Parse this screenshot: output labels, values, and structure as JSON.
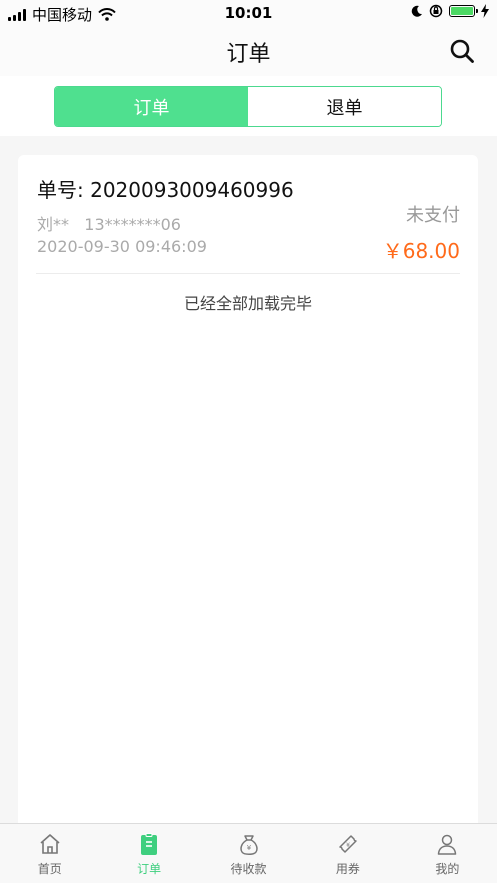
{
  "status_bar": {
    "carrier": "中国移动",
    "time": "10:01"
  },
  "nav": {
    "title": "订单"
  },
  "segments": [
    {
      "label": "订单",
      "active": true
    },
    {
      "label": "退单",
      "active": false
    }
  ],
  "order": {
    "number": "单号: 2020093009460996",
    "user": "刘**   13*******06",
    "time": "2020-09-30 09:46:09",
    "status": "未支付",
    "price": "￥68.00"
  },
  "list_footer": "已经全部加载完毕",
  "tabbar": [
    {
      "label": "首页",
      "icon": "home-icon"
    },
    {
      "label": "订单",
      "icon": "clipboard-icon",
      "active": true
    },
    {
      "label": "待收款",
      "icon": "money-bag-icon"
    },
    {
      "label": "用券",
      "icon": "ticket-icon"
    },
    {
      "label": "我的",
      "icon": "user-icon"
    }
  ],
  "colors": {
    "accent": "#4fe08f",
    "price": "#ff6a1a",
    "battery": "#4cd964"
  }
}
